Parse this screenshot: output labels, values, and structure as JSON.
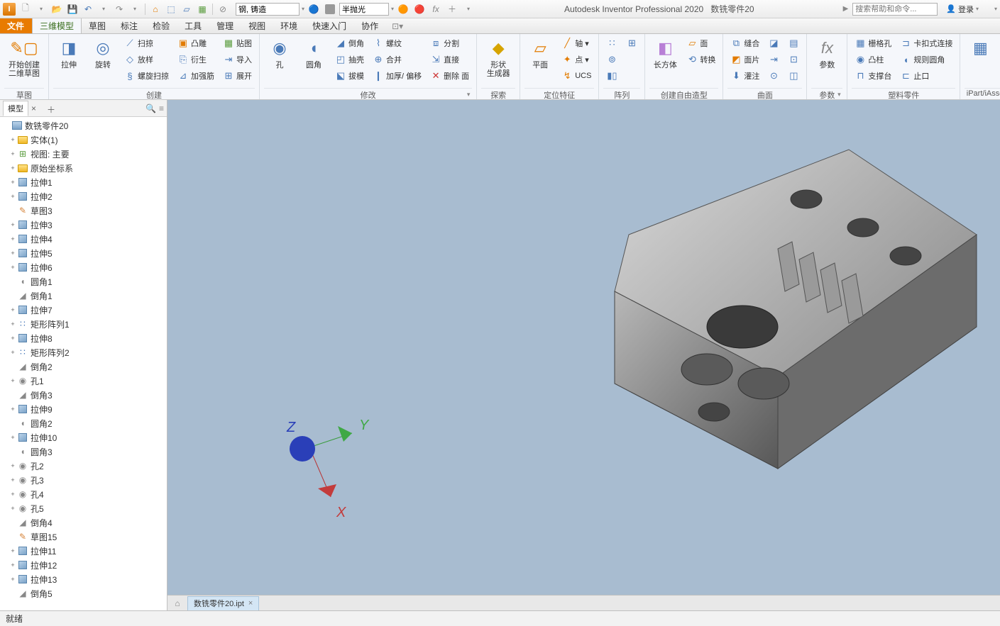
{
  "app": {
    "title": "Autodesk Inventor Professional 2020",
    "document": "数铣零件20",
    "search_placeholder": "搜索帮助和命令...",
    "login": "登录",
    "status": "就绪"
  },
  "qat": {
    "material_value": "钢, 铸造",
    "appearance_value": "半抛光"
  },
  "menubar": {
    "file": "文件",
    "tabs": [
      "三维模型",
      "草图",
      "标注",
      "检验",
      "工具",
      "管理",
      "视图",
      "环境",
      "快速入门",
      "协作"
    ]
  },
  "ribbon": {
    "sketch": {
      "start_2d": "开始创建\n二维草图",
      "label": "草图"
    },
    "create": {
      "extrude": "拉伸",
      "revolve": "旋转",
      "sweep": "扫掠",
      "loft": "放样",
      "coil": "螺旋扫掠",
      "emboss": "凸雕",
      "derive": "衍生",
      "rib": "加强筋",
      "decal": "贴图",
      "import": "导入",
      "unfold": "展开",
      "label": "创建"
    },
    "modify": {
      "hole": "孔",
      "fillet": "圆角",
      "chamfer": "倒角",
      "shell": "抽壳",
      "draft": "拔模",
      "thread": "螺纹",
      "combine": "合并",
      "thicken": "加厚/ 偏移",
      "split": "分割",
      "direct": "直接",
      "deleteface": "删除 面",
      "label": "修改"
    },
    "explore": {
      "shape_gen": "形状\n生成器",
      "label": "探索"
    },
    "workfeat": {
      "plane": "平面",
      "axis": "轴",
      "point": "点",
      "ucs": "UCS",
      "label": "定位特征"
    },
    "pattern": {
      "label": "阵列"
    },
    "freeform": {
      "box": "长方体",
      "convert": "转换",
      "face": "面",
      "label": "创建自由造型"
    },
    "surface": {
      "stitch": "缝合",
      "patch": "面片",
      "sculpt": "灌注",
      "label": "曲面"
    },
    "params": {
      "fx": "参数",
      "label": "参数"
    },
    "plastic": {
      "grill": "栅格孔",
      "boss": "凸柱",
      "rest": "支撑台",
      "snap": "卡扣式连接",
      "rule": "规则圆角",
      "lip": "止口",
      "label": "塑料零件"
    },
    "ipart": {
      "label": "iPart/iAssembly"
    }
  },
  "browser": {
    "tab": "模型",
    "root": "数铣零件20",
    "items": [
      {
        "t": "实体(1)",
        "ic": "folder",
        "exp": true
      },
      {
        "t": "视图: 主要",
        "ic": "view",
        "exp": true
      },
      {
        "t": "原始坐标系",
        "ic": "folder",
        "exp": true
      },
      {
        "t": "拉伸1",
        "ic": "extrude",
        "exp": true
      },
      {
        "t": "拉伸2",
        "ic": "extrude",
        "exp": true
      },
      {
        "t": "草图3",
        "ic": "sketch",
        "exp": false
      },
      {
        "t": "拉伸3",
        "ic": "extrude",
        "exp": true
      },
      {
        "t": "拉伸4",
        "ic": "extrude",
        "exp": true
      },
      {
        "t": "拉伸5",
        "ic": "extrude",
        "exp": true
      },
      {
        "t": "拉伸6",
        "ic": "extrude",
        "exp": true
      },
      {
        "t": "圆角1",
        "ic": "fillet",
        "exp": false
      },
      {
        "t": "倒角1",
        "ic": "chamfer",
        "exp": false
      },
      {
        "t": "拉伸7",
        "ic": "extrude",
        "exp": true
      },
      {
        "t": "矩形阵列1",
        "ic": "pattern",
        "exp": true
      },
      {
        "t": "拉伸8",
        "ic": "extrude",
        "exp": true
      },
      {
        "t": "矩形阵列2",
        "ic": "pattern",
        "exp": true
      },
      {
        "t": "倒角2",
        "ic": "chamfer",
        "exp": false
      },
      {
        "t": "孔1",
        "ic": "hole",
        "exp": true
      },
      {
        "t": "倒角3",
        "ic": "chamfer",
        "exp": false
      },
      {
        "t": "拉伸9",
        "ic": "extrude",
        "exp": true
      },
      {
        "t": "圆角2",
        "ic": "fillet",
        "exp": false
      },
      {
        "t": "拉伸10",
        "ic": "extrude",
        "exp": true
      },
      {
        "t": "圆角3",
        "ic": "fillet",
        "exp": false
      },
      {
        "t": "孔2",
        "ic": "hole",
        "exp": true
      },
      {
        "t": "孔3",
        "ic": "hole",
        "exp": true
      },
      {
        "t": "孔4",
        "ic": "hole",
        "exp": true
      },
      {
        "t": "孔5",
        "ic": "hole",
        "exp": true
      },
      {
        "t": "倒角4",
        "ic": "chamfer",
        "exp": false
      },
      {
        "t": "草图15",
        "ic": "sketch",
        "exp": false
      },
      {
        "t": "拉伸11",
        "ic": "extrude",
        "exp": true
      },
      {
        "t": "拉伸12",
        "ic": "extrude",
        "exp": true
      },
      {
        "t": "拉伸13",
        "ic": "extrude",
        "exp": true
      },
      {
        "t": "倒角5",
        "ic": "chamfer",
        "exp": false
      }
    ]
  },
  "doctab": {
    "name": "数铣零件20.ipt"
  },
  "triad": {
    "x": "X",
    "y": "Y",
    "z": "Z"
  }
}
